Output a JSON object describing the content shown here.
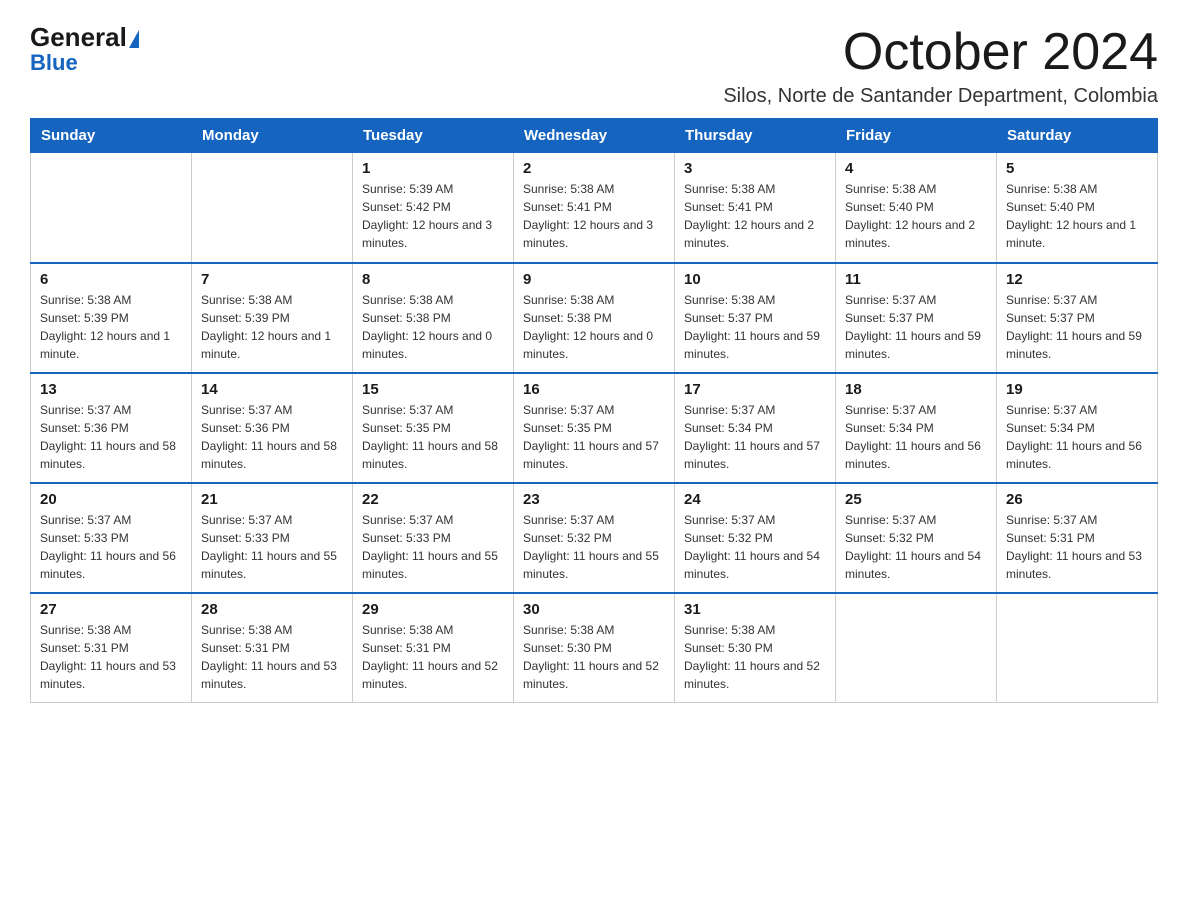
{
  "logo": {
    "general": "General",
    "triangle_color": "#1565c0",
    "blue": "Blue"
  },
  "header": {
    "title": "October 2024",
    "subtitle": "Silos, Norte de Santander Department, Colombia"
  },
  "weekdays": [
    "Sunday",
    "Monday",
    "Tuesday",
    "Wednesday",
    "Thursday",
    "Friday",
    "Saturday"
  ],
  "weeks": [
    [
      {
        "day": "",
        "sunrise": "",
        "sunset": "",
        "daylight": ""
      },
      {
        "day": "",
        "sunrise": "",
        "sunset": "",
        "daylight": ""
      },
      {
        "day": "1",
        "sunrise": "Sunrise: 5:39 AM",
        "sunset": "Sunset: 5:42 PM",
        "daylight": "Daylight: 12 hours and 3 minutes."
      },
      {
        "day": "2",
        "sunrise": "Sunrise: 5:38 AM",
        "sunset": "Sunset: 5:41 PM",
        "daylight": "Daylight: 12 hours and 3 minutes."
      },
      {
        "day": "3",
        "sunrise": "Sunrise: 5:38 AM",
        "sunset": "Sunset: 5:41 PM",
        "daylight": "Daylight: 12 hours and 2 minutes."
      },
      {
        "day": "4",
        "sunrise": "Sunrise: 5:38 AM",
        "sunset": "Sunset: 5:40 PM",
        "daylight": "Daylight: 12 hours and 2 minutes."
      },
      {
        "day": "5",
        "sunrise": "Sunrise: 5:38 AM",
        "sunset": "Sunset: 5:40 PM",
        "daylight": "Daylight: 12 hours and 1 minute."
      }
    ],
    [
      {
        "day": "6",
        "sunrise": "Sunrise: 5:38 AM",
        "sunset": "Sunset: 5:39 PM",
        "daylight": "Daylight: 12 hours and 1 minute."
      },
      {
        "day": "7",
        "sunrise": "Sunrise: 5:38 AM",
        "sunset": "Sunset: 5:39 PM",
        "daylight": "Daylight: 12 hours and 1 minute."
      },
      {
        "day": "8",
        "sunrise": "Sunrise: 5:38 AM",
        "sunset": "Sunset: 5:38 PM",
        "daylight": "Daylight: 12 hours and 0 minutes."
      },
      {
        "day": "9",
        "sunrise": "Sunrise: 5:38 AM",
        "sunset": "Sunset: 5:38 PM",
        "daylight": "Daylight: 12 hours and 0 minutes."
      },
      {
        "day": "10",
        "sunrise": "Sunrise: 5:38 AM",
        "sunset": "Sunset: 5:37 PM",
        "daylight": "Daylight: 11 hours and 59 minutes."
      },
      {
        "day": "11",
        "sunrise": "Sunrise: 5:37 AM",
        "sunset": "Sunset: 5:37 PM",
        "daylight": "Daylight: 11 hours and 59 minutes."
      },
      {
        "day": "12",
        "sunrise": "Sunrise: 5:37 AM",
        "sunset": "Sunset: 5:37 PM",
        "daylight": "Daylight: 11 hours and 59 minutes."
      }
    ],
    [
      {
        "day": "13",
        "sunrise": "Sunrise: 5:37 AM",
        "sunset": "Sunset: 5:36 PM",
        "daylight": "Daylight: 11 hours and 58 minutes."
      },
      {
        "day": "14",
        "sunrise": "Sunrise: 5:37 AM",
        "sunset": "Sunset: 5:36 PM",
        "daylight": "Daylight: 11 hours and 58 minutes."
      },
      {
        "day": "15",
        "sunrise": "Sunrise: 5:37 AM",
        "sunset": "Sunset: 5:35 PM",
        "daylight": "Daylight: 11 hours and 58 minutes."
      },
      {
        "day": "16",
        "sunrise": "Sunrise: 5:37 AM",
        "sunset": "Sunset: 5:35 PM",
        "daylight": "Daylight: 11 hours and 57 minutes."
      },
      {
        "day": "17",
        "sunrise": "Sunrise: 5:37 AM",
        "sunset": "Sunset: 5:34 PM",
        "daylight": "Daylight: 11 hours and 57 minutes."
      },
      {
        "day": "18",
        "sunrise": "Sunrise: 5:37 AM",
        "sunset": "Sunset: 5:34 PM",
        "daylight": "Daylight: 11 hours and 56 minutes."
      },
      {
        "day": "19",
        "sunrise": "Sunrise: 5:37 AM",
        "sunset": "Sunset: 5:34 PM",
        "daylight": "Daylight: 11 hours and 56 minutes."
      }
    ],
    [
      {
        "day": "20",
        "sunrise": "Sunrise: 5:37 AM",
        "sunset": "Sunset: 5:33 PM",
        "daylight": "Daylight: 11 hours and 56 minutes."
      },
      {
        "day": "21",
        "sunrise": "Sunrise: 5:37 AM",
        "sunset": "Sunset: 5:33 PM",
        "daylight": "Daylight: 11 hours and 55 minutes."
      },
      {
        "day": "22",
        "sunrise": "Sunrise: 5:37 AM",
        "sunset": "Sunset: 5:33 PM",
        "daylight": "Daylight: 11 hours and 55 minutes."
      },
      {
        "day": "23",
        "sunrise": "Sunrise: 5:37 AM",
        "sunset": "Sunset: 5:32 PM",
        "daylight": "Daylight: 11 hours and 55 minutes."
      },
      {
        "day": "24",
        "sunrise": "Sunrise: 5:37 AM",
        "sunset": "Sunset: 5:32 PM",
        "daylight": "Daylight: 11 hours and 54 minutes."
      },
      {
        "day": "25",
        "sunrise": "Sunrise: 5:37 AM",
        "sunset": "Sunset: 5:32 PM",
        "daylight": "Daylight: 11 hours and 54 minutes."
      },
      {
        "day": "26",
        "sunrise": "Sunrise: 5:37 AM",
        "sunset": "Sunset: 5:31 PM",
        "daylight": "Daylight: 11 hours and 53 minutes."
      }
    ],
    [
      {
        "day": "27",
        "sunrise": "Sunrise: 5:38 AM",
        "sunset": "Sunset: 5:31 PM",
        "daylight": "Daylight: 11 hours and 53 minutes."
      },
      {
        "day": "28",
        "sunrise": "Sunrise: 5:38 AM",
        "sunset": "Sunset: 5:31 PM",
        "daylight": "Daylight: 11 hours and 53 minutes."
      },
      {
        "day": "29",
        "sunrise": "Sunrise: 5:38 AM",
        "sunset": "Sunset: 5:31 PM",
        "daylight": "Daylight: 11 hours and 52 minutes."
      },
      {
        "day": "30",
        "sunrise": "Sunrise: 5:38 AM",
        "sunset": "Sunset: 5:30 PM",
        "daylight": "Daylight: 11 hours and 52 minutes."
      },
      {
        "day": "31",
        "sunrise": "Sunrise: 5:38 AM",
        "sunset": "Sunset: 5:30 PM",
        "daylight": "Daylight: 11 hours and 52 minutes."
      },
      {
        "day": "",
        "sunrise": "",
        "sunset": "",
        "daylight": ""
      },
      {
        "day": "",
        "sunrise": "",
        "sunset": "",
        "daylight": ""
      }
    ]
  ]
}
